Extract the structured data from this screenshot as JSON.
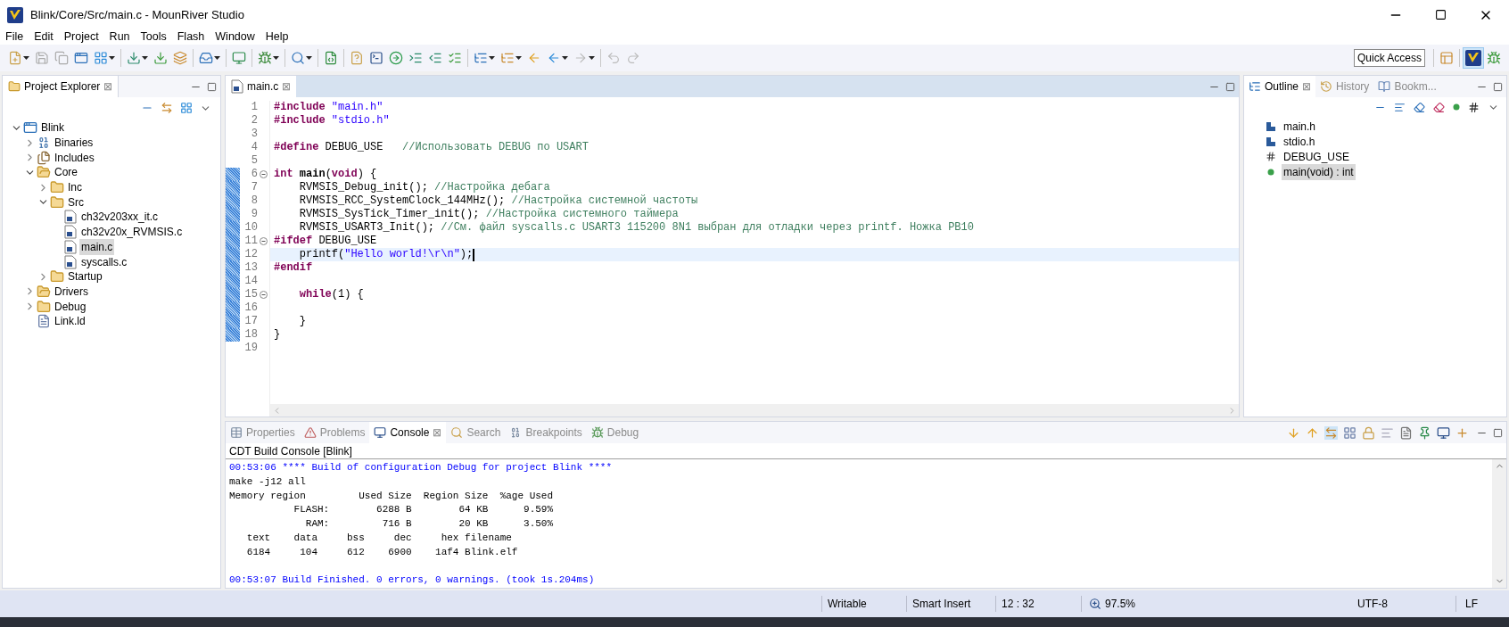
{
  "window": {
    "title": "Blink/Core/Src/main.c - MounRiver Studio"
  },
  "menu": [
    "File",
    "Edit",
    "Project",
    "Run",
    "Tools",
    "Flash",
    "Window",
    "Help"
  ],
  "quick_access": "Quick Access",
  "project_explorer": {
    "title": "Project Explorer",
    "close": "⊠",
    "tree": [
      {
        "label": "Blink",
        "kind": "project",
        "expanded": true,
        "selected": false,
        "children": [
          {
            "label": "Binaries",
            "kind": "binaries",
            "expanded": false,
            "selected": false
          },
          {
            "label": "Includes",
            "kind": "includes",
            "expanded": false,
            "selected": false
          },
          {
            "label": "Core",
            "kind": "source-folder",
            "expanded": true,
            "selected": false,
            "children": [
              {
                "label": "Inc",
                "kind": "folder",
                "expanded": false,
                "selected": false
              },
              {
                "label": "Src",
                "kind": "folder",
                "expanded": true,
                "selected": false,
                "children": [
                  {
                    "label": "ch32v203xx_it.c",
                    "kind": "c-file",
                    "selected": false
                  },
                  {
                    "label": "ch32v20x_RVMSIS.c",
                    "kind": "c-file",
                    "selected": false
                  },
                  {
                    "label": "main.c",
                    "kind": "c-file",
                    "selected": true
                  },
                  {
                    "label": "syscalls.c",
                    "kind": "c-file",
                    "selected": false
                  }
                ]
              },
              {
                "label": "Startup",
                "kind": "folder",
                "expanded": false,
                "selected": false
              }
            ]
          },
          {
            "label": "Drivers",
            "kind": "source-folder",
            "expanded": false,
            "selected": false
          },
          {
            "label": "Debug",
            "kind": "folder",
            "expanded": false,
            "selected": false
          },
          {
            "label": "Link.ld",
            "kind": "text-file",
            "selected": false
          }
        ]
      }
    ]
  },
  "editor": {
    "tabs": [
      {
        "label": "main.c",
        "close": "⊠",
        "selected": true
      }
    ],
    "lines": [
      {
        "number": "1",
        "changed": false,
        "fold": false,
        "current": false,
        "tokens": [
          {
            "kind": "kw",
            "text": "#include"
          },
          {
            "kind": "str",
            "text": " \"main.h\""
          }
        ]
      },
      {
        "number": "2",
        "changed": false,
        "fold": false,
        "current": false,
        "tokens": [
          {
            "kind": "kw",
            "text": "#include"
          },
          {
            "kind": "str",
            "text": " \"stdio.h\""
          }
        ]
      },
      {
        "number": "3",
        "changed": false,
        "fold": false,
        "current": false
      },
      {
        "number": "4",
        "changed": false,
        "fold": false,
        "current": false,
        "tokens": [
          {
            "kind": "kw",
            "text": "#define"
          },
          {
            "kind": "txt",
            "text": " DEBUG_USE   "
          },
          {
            "kind": "cmt",
            "text": "//Использовать DEBUG по USART"
          }
        ]
      },
      {
        "number": "5",
        "changed": false,
        "fold": false,
        "current": false
      },
      {
        "number": "6",
        "changed": true,
        "fold": true,
        "current": false,
        "tokens": [
          {
            "kind": "kw",
            "text": "int"
          },
          {
            "kind": "fn",
            "text": " main"
          },
          {
            "kind": "txt",
            "text": "("
          },
          {
            "kind": "kw",
            "text": "void"
          },
          {
            "kind": "txt",
            "text": ") {"
          }
        ]
      },
      {
        "number": "7",
        "changed": true,
        "fold": false,
        "current": false,
        "tokens": [
          {
            "kind": "txt",
            "text": "    RVMSIS_Debug_init(); "
          },
          {
            "kind": "cmt",
            "text": "//Настройка дебага"
          }
        ]
      },
      {
        "number": "8",
        "changed": true,
        "fold": false,
        "current": false,
        "tokens": [
          {
            "kind": "txt",
            "text": "    RVMSIS_RCC_SystemClock_144MHz(); "
          },
          {
            "kind": "cmt",
            "text": "//Настройка системной частоты"
          }
        ]
      },
      {
        "number": "9",
        "changed": true,
        "fold": false,
        "current": false,
        "tokens": [
          {
            "kind": "txt",
            "text": "    RVMSIS_SysTick_Timer_init(); "
          },
          {
            "kind": "cmt",
            "text": "//Настройка системного таймера"
          }
        ]
      },
      {
        "number": "10",
        "changed": true,
        "fold": false,
        "current": false,
        "tokens": [
          {
            "kind": "txt",
            "text": "    RVMSIS_USART3_Init(); "
          },
          {
            "kind": "cmt",
            "text": "//См. файл syscalls.c USART3 115200 8N1 выбран для отладки через printf. Ножка PB10"
          }
        ]
      },
      {
        "number": "11",
        "changed": true,
        "fold": true,
        "current": false,
        "tokens": [
          {
            "kind": "kw",
            "text": "#ifdef"
          },
          {
            "kind": "txt",
            "text": " DEBUG_USE"
          }
        ]
      },
      {
        "number": "12",
        "changed": true,
        "fold": false,
        "current": true,
        "tokens": [
          {
            "kind": "txt",
            "text": "    printf("
          },
          {
            "kind": "str",
            "text": "\"Hello world!\\r\\n\""
          },
          {
            "kind": "txt",
            "text": ");"
          }
        ]
      },
      {
        "number": "13",
        "changed": true,
        "fold": false,
        "current": false,
        "tokens": [
          {
            "kind": "kw",
            "text": "#endif"
          }
        ]
      },
      {
        "number": "14",
        "changed": true,
        "fold": false,
        "current": false
      },
      {
        "number": "15",
        "changed": true,
        "fold": true,
        "current": false,
        "tokens": [
          {
            "kind": "kw",
            "text": "    while"
          },
          {
            "kind": "txt",
            "text": "(1) {"
          }
        ]
      },
      {
        "number": "16",
        "changed": true,
        "fold": false,
        "current": false
      },
      {
        "number": "17",
        "changed": true,
        "fold": false,
        "current": false,
        "tokens": [
          {
            "kind": "txt",
            "text": "    }"
          }
        ]
      },
      {
        "number": "18",
        "changed": true,
        "fold": false,
        "current": false,
        "tokens": [
          {
            "kind": "txt",
            "text": "}"
          }
        ]
      },
      {
        "number": "19",
        "changed": false,
        "fold": false,
        "current": false
      }
    ]
  },
  "outline": {
    "tabs": [
      {
        "label": "Outline",
        "kind": "outline",
        "selected": true
      },
      {
        "label": "History",
        "kind": "history",
        "selected": false
      },
      {
        "label": "Bookm...",
        "kind": "bookmarks",
        "selected": false
      }
    ],
    "close": "⊠",
    "items": [
      {
        "label": "main.h",
        "kind": "include",
        "selected": false
      },
      {
        "label": "stdio.h",
        "kind": "include",
        "selected": false
      },
      {
        "label": "DEBUG_USE",
        "kind": "macro",
        "selected": false
      },
      {
        "label": "main(void) : int",
        "kind": "function",
        "selected": true
      }
    ]
  },
  "console": {
    "tabs": [
      {
        "label": "Properties",
        "kind": "properties",
        "selected": false
      },
      {
        "label": "Problems",
        "kind": "problems",
        "selected": false
      },
      {
        "label": "Console",
        "kind": "console",
        "selected": true
      },
      {
        "label": "Search",
        "kind": "search",
        "selected": false
      },
      {
        "label": "Breakpoints",
        "kind": "breakpoints",
        "selected": false
      },
      {
        "label": "Debug",
        "kind": "debug",
        "selected": false
      }
    ],
    "close": "⊠",
    "title": "CDT Build Console [Blink]",
    "lines": [
      {
        "kind": "info",
        "text": "00:53:06 **** Build of configuration Debug for project Blink ****"
      },
      {
        "kind": "out",
        "text": "make -j12 all"
      },
      {
        "kind": "out",
        "text": "Memory region         Used Size  Region Size  %age Used"
      },
      {
        "kind": "out",
        "text": "           FLASH:        6288 B        64 KB      9.59%"
      },
      {
        "kind": "out",
        "text": "             RAM:         716 B        20 KB      3.50%"
      },
      {
        "kind": "out",
        "text": "   text    data     bss     dec     hex filename"
      },
      {
        "kind": "out",
        "text": "   6184     104     612    6900    1af4 Blink.elf"
      },
      {
        "kind": "blank"
      },
      {
        "kind": "info",
        "text": "00:53:07 Build Finished. 0 errors, 0 warnings. (took 1s.204ms)"
      }
    ]
  },
  "status_bar": {
    "writable": "Writable",
    "insert_mode": "Smart Insert",
    "position": "12 : 32",
    "zoom": "97.5%",
    "encoding": "UTF-8",
    "line_ending": "LF"
  }
}
